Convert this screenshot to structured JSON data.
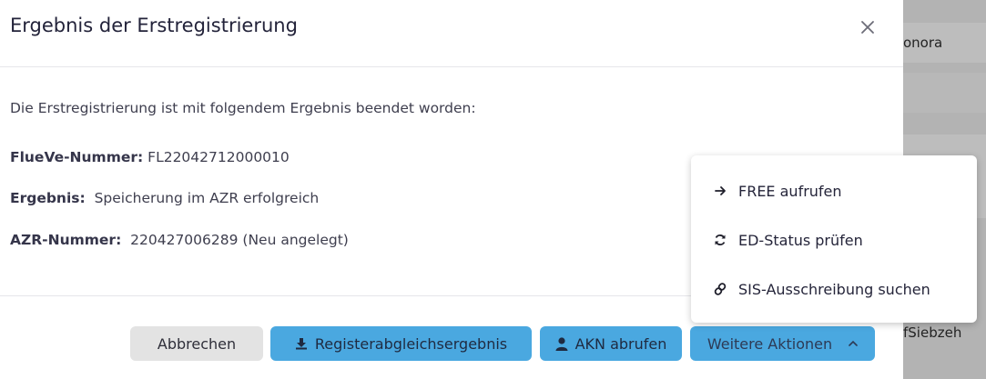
{
  "background": {
    "row1_text": "onora",
    "row4_text": "fSiebzeh"
  },
  "modal": {
    "title": "Ergebnis der Erstregistrierung",
    "intro": "Die Erstregistrierung ist mit folgendem Ergebnis beendet worden:",
    "fields": [
      {
        "label": "FlueVe-Nummer:",
        "value": "FL22042712000010"
      },
      {
        "label": "Ergebnis:",
        "value": "Speicherung im AZR erfolgreich"
      },
      {
        "label": "AZR-Nummer:",
        "value": "220427006289 (Neu angelegt)"
      }
    ]
  },
  "footer": {
    "cancel_label": "Abbrechen",
    "register_label": "Registerabgleichsergebnis",
    "akn_label": "AKN abrufen",
    "more_label": "Weitere Aktionen"
  },
  "dropdown": {
    "items": [
      {
        "label": "FREE aufrufen",
        "icon": "arrow-right-icon"
      },
      {
        "label": "ED-Status prüfen",
        "icon": "sync-icon"
      },
      {
        "label": "SIS-Ausschreibung suchen",
        "icon": "link-icon"
      }
    ]
  },
  "colors": {
    "primary_button": "#4aa8e0",
    "secondary_button": "#e3e3e3"
  }
}
